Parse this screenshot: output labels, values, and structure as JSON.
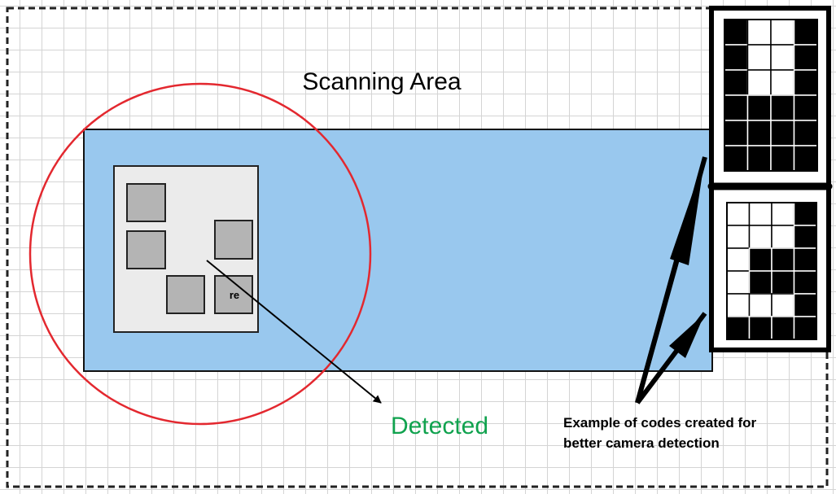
{
  "labels": {
    "scanning_area": "Scanning Area",
    "detected": "Detected",
    "example_line1": "Example of codes created for",
    "example_line2": "better camera detection",
    "marker_text": "re"
  },
  "colors": {
    "scan_zone": "#99c8ee",
    "detection_circle": "#e3282f",
    "detected_text": "#10a24e",
    "object_panel": "#ebebeb",
    "marker": "#b4b4b4"
  },
  "codes": {
    "top": [
      [
        1,
        0,
        0,
        1
      ],
      [
        1,
        0,
        0,
        1
      ],
      [
        1,
        0,
        0,
        1
      ],
      [
        1,
        1,
        1,
        1
      ],
      [
        1,
        1,
        1,
        1
      ],
      [
        1,
        1,
        1,
        1
      ]
    ],
    "bottom": [
      [
        0,
        0,
        0,
        1
      ],
      [
        0,
        0,
        0,
        1
      ],
      [
        0,
        1,
        1,
        1
      ],
      [
        0,
        1,
        1,
        1
      ],
      [
        0,
        0,
        0,
        1
      ],
      [
        1,
        1,
        1,
        1
      ]
    ]
  }
}
